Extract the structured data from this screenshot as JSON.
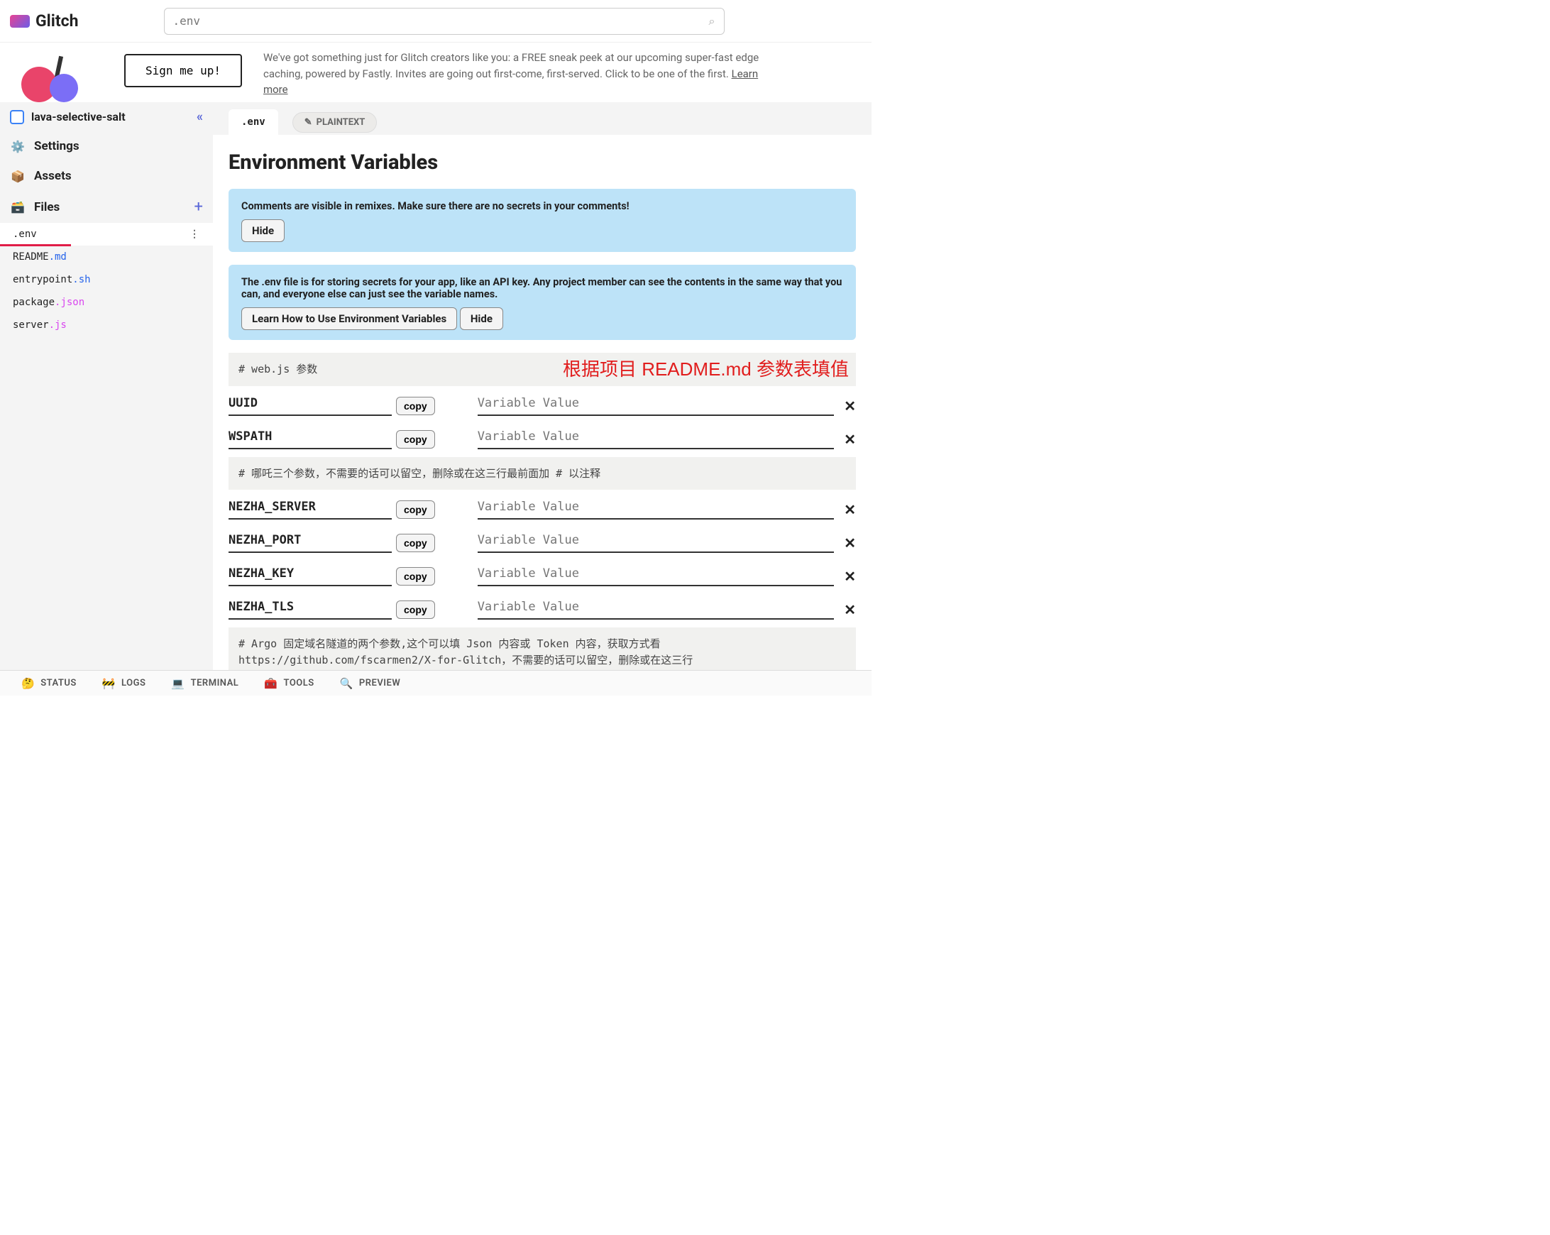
{
  "brand": "Glitch",
  "search_placeholder": ".env",
  "signup_label": "Sign me up!",
  "banner_text": "We've got something just for Glitch creators like you: a FREE sneak peek at our upcoming super-fast edge caching, powered by Fastly. Invites are going out first-come, first-served. Click to be one of the first. ",
  "banner_link": "Learn more",
  "project_name": "lava-selective-salt",
  "sidebar": {
    "settings": "Settings",
    "assets": "Assets",
    "files": "Files"
  },
  "files": [
    {
      "name": ".env",
      "ext": "",
      "active": true
    },
    {
      "name": "README",
      "ext": ".md",
      "ext_cls": "ext-md"
    },
    {
      "name": "entrypoint",
      "ext": ".sh",
      "ext_cls": "ext-sh"
    },
    {
      "name": "package",
      "ext": ".json",
      "ext_cls": "ext-json"
    },
    {
      "name": "server",
      "ext": ".js",
      "ext_cls": "ext-js"
    }
  ],
  "tab_label": ".env",
  "pill_label": "PLAINTEXT",
  "page_title": "Environment Variables",
  "alert1_text": "Comments are visible in remixes. Make sure there are no secrets in your comments!",
  "alert1_btn": "Hide",
  "alert2_text": "The .env file is for storing secrets for your app, like an API key. Any project member can see the contents in the same way that you can, and everyone else can just see the variable names.",
  "alert2_btn1": "Learn How to Use Environment Variables",
  "alert2_btn2": "Hide",
  "comment1": "# web.js 参数",
  "red_annotation": "根据项目 README.md 参数表填值",
  "copy_label": "copy",
  "value_placeholder": "Variable Value",
  "vars1": [
    "UUID",
    "WSPATH"
  ],
  "comment2": "# 哪吒三个参数，不需要的话可以留空，删除或在这三行最前面加 # 以注释",
  "vars2": [
    "NEZHA_SERVER",
    "NEZHA_PORT",
    "NEZHA_KEY",
    "NEZHA_TLS"
  ],
  "comment3": "# Argo 固定域名隧道的两个参数,这个可以填 Json 内容或 Token 内容，获取方式看 https://github.com/fscarmen2/X-for-Glitch，不需要的话可以留空，删除或在这三行",
  "bottom": {
    "status": "STATUS",
    "logs": "LOGS",
    "terminal": "TERMINAL",
    "tools": "TOOLS",
    "preview": "PREVIEW"
  }
}
